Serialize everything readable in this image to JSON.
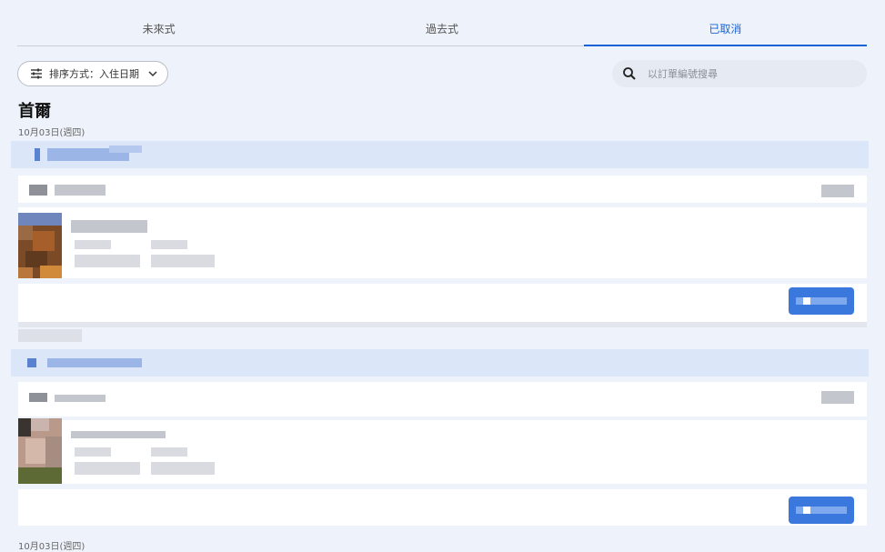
{
  "tabs": [
    {
      "label": "未來式",
      "active": false
    },
    {
      "label": "過去式",
      "active": false
    },
    {
      "label": "已取消",
      "active": true
    }
  ],
  "sort": {
    "label": "排序方式：入住日期",
    "icon": "sliders-icon"
  },
  "search": {
    "placeholder": "以訂單編號搜尋",
    "value": ""
  },
  "group": {
    "city": "首爾",
    "date": "10月03日(週四)"
  },
  "next_group": {
    "date": "10月03日(週四)"
  },
  "colors": {
    "accent": "#1a63d6",
    "background": "#eef2fa",
    "card_header": "#dbe6f9"
  }
}
